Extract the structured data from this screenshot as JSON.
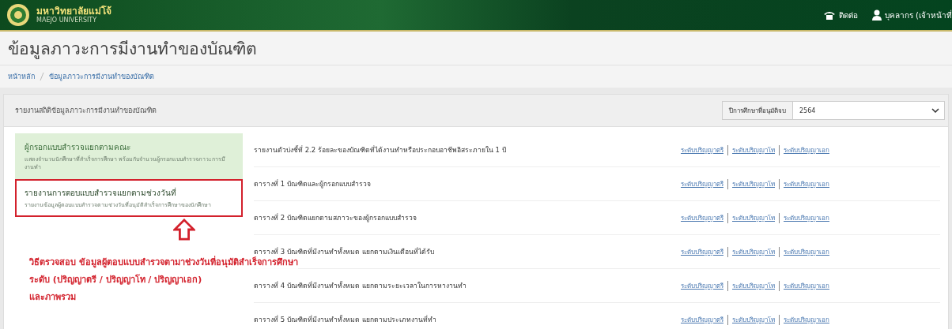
{
  "header": {
    "university_name": "มหาวิทยาลัยแม่โจ้",
    "university_subtitle": "MAEJO UNIVERSITY",
    "contact_link": "ติดต่อ",
    "user_link": "บุคลากร (เจ้าหน้าที่"
  },
  "page_title": "ข้อมูลภาวะการมีงานทำของบัณฑิต",
  "breadcrumb": [
    {
      "label": "หน้าหลัก"
    },
    {
      "label": "ข้อมูลภาวะการมีงานทำของบัณฑิต"
    }
  ],
  "panel": {
    "title": "รายงานสถิติข้อมูลภาวะการมีงานทำของบัณฑิต",
    "filter_label": "ปีการศึกษาที่อนุมัติจบ",
    "filter_value": "2564"
  },
  "menu": [
    {
      "title": "ผู้กรอกแบบสำรวจแยกตามคณะ",
      "description": "แสดงจำนวนนักศึกษาที่สำเร็จการศึกษา พร้อมกับจำนวนผู้กรอกแบบสำรวจภาวะการมีงานทำ",
      "selected": true,
      "highlighted": false
    },
    {
      "title": "รายงานการตอบแบบสำรวจแยกตามช่วงวันที่",
      "description": "รายงานข้อมูลผู้ตอบแบบสำรวจตามช่วงวันที่อนุมัติสำเร็จการศึกษาของนักศึกษา",
      "selected": false,
      "highlighted": true
    }
  ],
  "annotation": {
    "lines": [
      "วิธีตรวจสอบ ข้อมูลผู้ตอบแบบสำรวจตามาช่วงวันที่อนุมัติสำเร็จการศึกษา",
      "ระดับ (ปริญญาตรี / ปริญญาโท / ปริญญาเอก)",
      "และภาพรวม"
    ]
  },
  "reports": [
    {
      "title": "รายงานตัวบ่งชี้ที่ 2.2 ร้อยละของบัณฑิตที่ได้งานทำหรือประกอบอาชีพอิสระภายใน 1 ปี",
      "links": [
        "ระดับปริญญาตรี",
        "ระดับปริญญาโท",
        "ระดับปริญญาเอก"
      ]
    },
    {
      "title": "ตารางที่ 1 บัณฑิตและผู้กรอกแบบสำรวจ",
      "links": [
        "ระดับปริญญาตรี",
        "ระดับปริญญาโท",
        "ระดับปริญญาเอก"
      ]
    },
    {
      "title": "ตารางที่ 2 บัณฑิตแยกตามสภาวะของผู้กรอกแบบสำรวจ",
      "links": [
        "ระดับปริญญาตรี",
        "ระดับปริญญาโท",
        "ระดับปริญญาเอก"
      ]
    },
    {
      "title": "ตารางที่ 3 บัณฑิตที่มีงานทำทั้งหมด แยกตามเงินเดือนที่ได้รับ",
      "links": [
        "ระดับปริญญาตรี",
        "ระดับปริญญาโท",
        "ระดับปริญญาเอก"
      ]
    },
    {
      "title": "ตารางที่ 4 บัณฑิตที่มีงานทำทั้งหมด แยกตามระยะเวลาในการหางานทำ",
      "links": [
        "ระดับปริญญาตรี",
        "ระดับปริญญาโท",
        "ระดับปริญญาเอก"
      ]
    },
    {
      "title": "ตารางที่ 5 บัณฑิตที่มีงานทำทั้งหมด แยกตามประเภทงานที่ทำ",
      "links": [
        "ระดับปริญญาตรี",
        "ระดับปริญญาโท",
        "ระดับปริญญาเอก"
      ]
    }
  ]
}
